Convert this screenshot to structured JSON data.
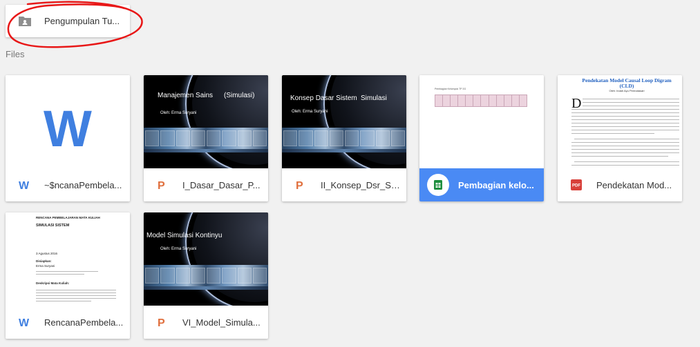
{
  "folder": {
    "name": "Pengumpulan Tu..."
  },
  "section_label": "Files",
  "files": [
    {
      "name": "~$ncanaPembela...",
      "type": "word-icon"
    },
    {
      "name": "I_Dasar_Dasar_P...",
      "type": "powerpoint-icon",
      "slide_title_a": "Manajemen Sains",
      "slide_title_b": "(Simulasi)",
      "slide_sub": "Oleh: Erma Suryani"
    },
    {
      "name": "II_Konsep_Dsr_Si...",
      "type": "powerpoint-icon",
      "slide_title_a": "Konsep Dasar Sistem",
      "slide_title_b": "Simulasi",
      "slide_sub": "Oleh: Erma Suryani"
    },
    {
      "name": "Pembagian kelo...",
      "type": "sheets-icon",
      "selected": true,
      "sheet_header": "Pembagian Kelompok TP 2G"
    },
    {
      "name": "Pendekatan Mod...",
      "type": "pdf-icon",
      "pdf_title": "Pendekatan Model Causal Loop Digram",
      "pdf_title2": "(CLD)",
      "pdf_author": "Oleh: Indah Ayu Permatasari"
    },
    {
      "name": "RencanaPembela...",
      "type": "word-icon",
      "doc_header": "RENCANA PEMBELAJARAN MATA KULIAH",
      "doc_title": "SIMULASI SISTEM",
      "doc_date": "3 Agustus 2016",
      "doc_h1": "Disiapkan:",
      "doc_name": "Erma Suryani",
      "doc_h2": "Deskripsi Mata Kuliah:"
    },
    {
      "name": "VI_Model_Simula...",
      "type": "powerpoint-icon",
      "slide_title_a": "Model Simulasi Kontinyu",
      "slide_sub": "Oleh: Erma Suryani"
    }
  ],
  "colors": {
    "accent": "#4a8af4",
    "word": "#3f7fe0",
    "powerpoint": "#e06f3d",
    "sheets": "#1e8e3e",
    "pdf": "#d8403a",
    "annotation": "#e81717"
  }
}
